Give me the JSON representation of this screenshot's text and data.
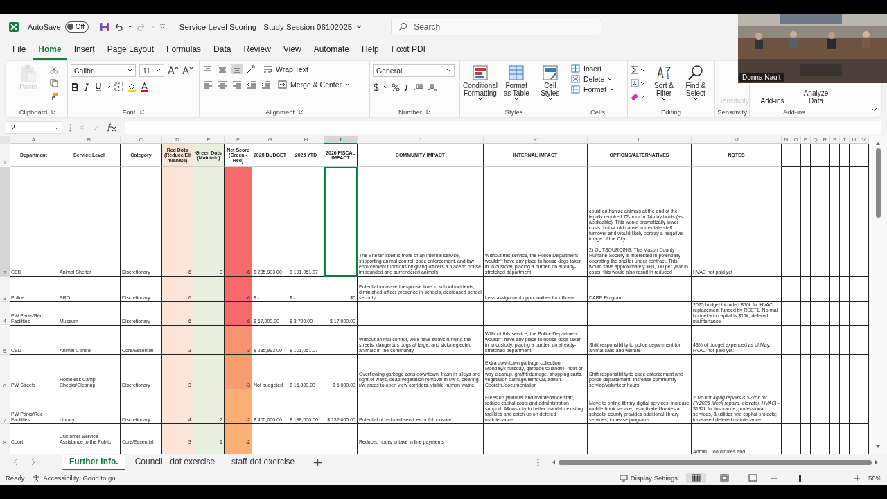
{
  "title_bar": {
    "autosave_label": "AutoSave",
    "autosave_on": false,
    "autosave_state": "Off",
    "document_title": "Service Level Scoring - Study Session 06102025",
    "search": {
      "placeholder": "Search"
    }
  },
  "menu_tabs": [
    {
      "label": "File",
      "selected": false
    },
    {
      "label": "Home",
      "selected": true
    },
    {
      "label": "Insert",
      "selected": false
    },
    {
      "label": "Page Layout",
      "selected": false
    },
    {
      "label": "Formulas",
      "selected": false
    },
    {
      "label": "Data",
      "selected": false
    },
    {
      "label": "Review",
      "selected": false
    },
    {
      "label": "View",
      "selected": false
    },
    {
      "label": "Automate",
      "selected": false
    },
    {
      "label": "Help",
      "selected": false
    },
    {
      "label": "Foxit PDF",
      "selected": false
    }
  ],
  "ribbon": {
    "clipboard": {
      "paste": "Paste",
      "paste_disabled": true,
      "label": "Clipboard"
    },
    "font": {
      "name": "Calibri",
      "size": "11",
      "label": "Font"
    },
    "alignment": {
      "wrap_text": "Wrap Text",
      "merge_center": "Merge & Center",
      "label": "Alignment"
    },
    "number": {
      "format": "General",
      "label": "Number"
    },
    "styles": {
      "buttons": [
        "Conditional Formatting",
        "Format as Table",
        "Cell Styles"
      ],
      "label": "Styles"
    },
    "cells": {
      "buttons": [
        "Insert",
        "Delete",
        "Format"
      ],
      "label": "Cells"
    },
    "editing": {
      "buttons": [
        "Sort & Filter",
        "Find & Select"
      ],
      "label": "Editing"
    },
    "sensitivity": {
      "button": "Sensitivity",
      "disabled": true,
      "label": "Sensitivity"
    },
    "add_ins": {
      "buttons": [
        "Add-ins",
        "Analyze Data"
      ],
      "label": "Add-ins"
    }
  },
  "formula_bar": {
    "name_box": "I2"
  },
  "sheet": {
    "column_letters": [
      {
        "label": "A",
        "selected": false
      },
      {
        "label": "B",
        "selected": false
      },
      {
        "label": "C",
        "selected": false
      },
      {
        "label": "D",
        "selected": false
      },
      {
        "label": "E",
        "selected": false
      },
      {
        "label": "F",
        "selected": false
      },
      {
        "label": "G",
        "selected": false
      },
      {
        "label": "H",
        "selected": false
      },
      {
        "label": "I",
        "selected": true
      },
      {
        "label": "J",
        "selected": false
      },
      {
        "label": "K",
        "selected": false
      },
      {
        "label": "L",
        "selected": false
      },
      {
        "label": "M",
        "selected": false
      },
      {
        "label": "N",
        "selected": false
      },
      {
        "label": "O",
        "selected": false
      },
      {
        "label": "P",
        "selected": false
      },
      {
        "label": "Q",
        "selected": false
      },
      {
        "label": "R",
        "selected": false
      },
      {
        "label": "S",
        "selected": false
      },
      {
        "label": "T",
        "selected": false
      },
      {
        "label": "U",
        "selected": false
      },
      {
        "label": "V",
        "selected": false
      }
    ],
    "header_row_number": "1",
    "headers": [
      "Department",
      "Service Level",
      "Category",
      "Red Dots (Reduce/Elimianate)",
      "Green Dots (Maintain)",
      "Net Score (Green - Red)",
      "2025 BUDGET",
      "2025 YTD",
      "2026 FISCAL IMPACT",
      "COMMUNITY IMPACT",
      "INTERNAL IMPACT",
      "OPTIONS/ALTERNATIVES",
      "NOTES"
    ],
    "rows": [
      {
        "row_number": "2",
        "selected": true,
        "color": "#f8696b",
        "department": "CED",
        "service_level": "Animal Shelter",
        "category": "Discretionary",
        "red_dots": "6",
        "green_dots": "0",
        "net_score": "-6",
        "budget_2025": "$ 235,993.00",
        "ytd_2025": "$ 101,051.07",
        "community_impact": "The Shelter itself is more of an internal service, supporting animal control, code enforcement, and law enforcement functions by giving officers a place to house impounded and surrendered animals.",
        "internal_impact": "Without this service, the Police Department wouldn't have any place to house dogs taken in to custody, placing a burden on already-stretched department.",
        "options": "could euthanize animals at the end of the legally required 72-hour or 14-day holds (as applicable). This would dramatically lower costs, but would cause immediate staff turnover and would likely portray a negative image of the City\n\n2) OUTSOURCING: The Mason County Humane Society is interested in potentially operating the shelter under contract. This would save approximately $80,000 per year in costs, this would also result in reduced",
        "notes": "HVAC not paid yet"
      },
      {
        "row_number": "3",
        "selected": false,
        "color": "#f8696b",
        "department": "Police",
        "service_level": "SRO",
        "category": "Discretionary",
        "red_dots": "6",
        "net_score": "-6",
        "budget_2025": "$ -",
        "ytd_2025": "$ -",
        "fiscal_impact_2026": "$0",
        "community_impact": "Potential increased response time to school incidents, diminished officer presence in schools, decreased school security.",
        "internal_impact": "Less assignment opportunities for officers.",
        "options": "DARE Program"
      },
      {
        "row_number": "4",
        "selected": false,
        "color": "#f8696b",
        "department": "PW Parks/Rec Facilities",
        "service_level": "Museum",
        "category": "Discretionary",
        "red_dots": "6",
        "net_score": "-6",
        "budget_2025": "$ 67,000.00",
        "ytd_2025": "$ 3,700.00",
        "fiscal_impact_2026": "$ 17,000.00",
        "notes": "2025 budget included $50k for HVAC replacement funded by REET1. Normal budget w/o capital is $17k, defered maintenance"
      },
      {
        "row_number": "5",
        "selected": false,
        "color": "#f9936f",
        "department": "CED",
        "service_level": "Animal Control",
        "category": "Core/Essential",
        "red_dots": "3",
        "net_score": "-3",
        "budget_2025": "$ 235,993.00",
        "ytd_2025": "$ 101,051.07",
        "community_impact": "Without animal control, we'll have strays running the streets, dangerous dogs at large, and sick/neglected animals in the community.",
        "internal_impact": "Without this service, the Police Department wouldn't have any place to house dogs taken in to custody, placing a burden on already-stretched department.",
        "options": "Shift responsibility to police department for animal calls and welfare",
        "notes": "43% of budget expended as of May. HVAC not paid yet."
      },
      {
        "row_number": "6",
        "selected": false,
        "color": "#fa9c72",
        "department": "PW Streets",
        "service_level": "Homeless Camp Checks/Cleanup",
        "category": "Discretionary",
        "red_dots": "3",
        "net_score": "-3",
        "budget_2025": "Not budgeted",
        "ytd_2025": "$ 15,000.00",
        "fiscal_impact_2026": "$ 5,000.00",
        "community_impact": "Overflowing garbage cans downtown, trash in alleys and right-of-ways, dead vegetation removal in r/w's, clearing r/w areas to open view corridors, visible human waste.",
        "internal_impact": "Extra downtown garbage collection Monday/Thursday, garbage to landfill, right-of-way cleanup, graffiti damage, shopping carts, vegetation damage/removal, admin. Coordin./documentation",
        "options": "Shift responsibility to code enforcement and police departement. Increase community service/volunteer hours."
      },
      {
        "row_number": "7",
        "selected": false,
        "color": "#fbaf77",
        "department": "PW Parks/Rec Facilities",
        "service_level": "Library",
        "category": "Discretionary",
        "red_dots": "4",
        "green_dots": "2",
        "net_score": "-2",
        "budget_2025": "$ 405,000.00",
        "ytd_2025": "$ 198,600.00",
        "fiscal_impact_2026": "$ 132,000.00",
        "community_impact": "Potential of reduced services or full closure.",
        "internal_impact": "Frees up janitorial and maintenance staff, reduce capital costs and administration support. Allows city to better maintain existing facilities and catch up on defered maintenance.",
        "options": "Move to online library digital services, increase mobile book service, re-activate libraries at schools, county provides additional library services, increase programs",
        "notes": "2025 libr *aging repairs & $275k for FY2026 (deck repairs, elevator, HVAC)* - $132k for insurance, professional services, & utilities w/o capital projects; increased defered maintenance."
      },
      {
        "row_number": "8",
        "selected": false,
        "color": "#fbb078",
        "department": "Court",
        "service_level": "Customer Service Assistance to the Public",
        "category": "Core/Essential",
        "red_dots": "3",
        "green_dots": "1",
        "net_score": "-2",
        "community_impact": "Reduced hours to take in line payments"
      },
      {
        "selected": false,
        "color": "#fbb078",
        "notes": "Admin. Coordinates and"
      }
    ]
  },
  "sheet_tabs": [
    {
      "label": "Further Info.",
      "selected": true
    },
    {
      "label": "Council - dot exercise",
      "selected": false
    },
    {
      "label": "staff-dot exercise",
      "selected": false
    }
  ],
  "status_bar": {
    "mode": "Ready",
    "accessibility": "Accessibility: Good to go",
    "display_settings": "Display Settings",
    "zoom": {
      "level": 0.25,
      "reading": "50%"
    }
  },
  "video_tile": {
    "kind": "picture",
    "participant_name": "Donna Nault"
  }
}
